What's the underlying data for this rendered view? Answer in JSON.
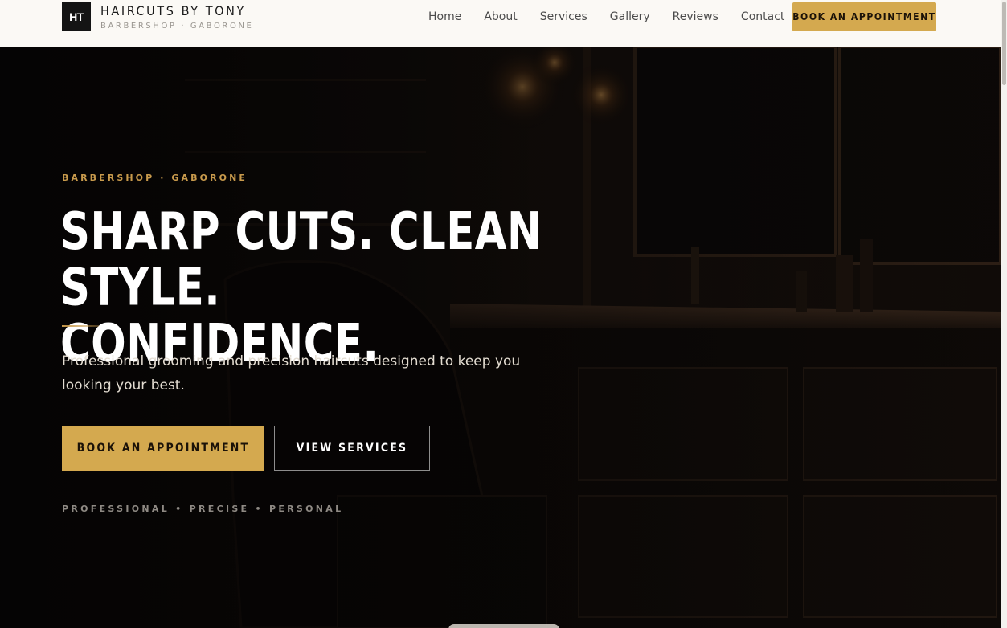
{
  "header": {
    "logo_mark": "HT",
    "brand_name": "HAIRCUTS BY TONY",
    "brand_sub": "BARBERSHOP · GABORONE",
    "nav": [
      "Home",
      "About",
      "Services",
      "Gallery",
      "Reviews",
      "Contact"
    ],
    "cta_label": "BOOK AN APPOINTMENT"
  },
  "hero": {
    "eyebrow": "BARBERSHOP · GABORONE",
    "headline_line1": "SHARP CUTS. CLEAN STYLE.",
    "headline_line2": "CONFIDENCE.",
    "lede": "Professional grooming and precision haircuts designed to keep you looking your best.",
    "primary_button": "BOOK AN APPOINTMENT",
    "secondary_button": "VIEW SERVICES",
    "tagline": "PROFESSIONAL • PRECISE • PERSONAL"
  },
  "colors": {
    "accent_gold": "#d4a94f",
    "header_bg": "#fbf9f5",
    "hero_bg": "#070505"
  }
}
